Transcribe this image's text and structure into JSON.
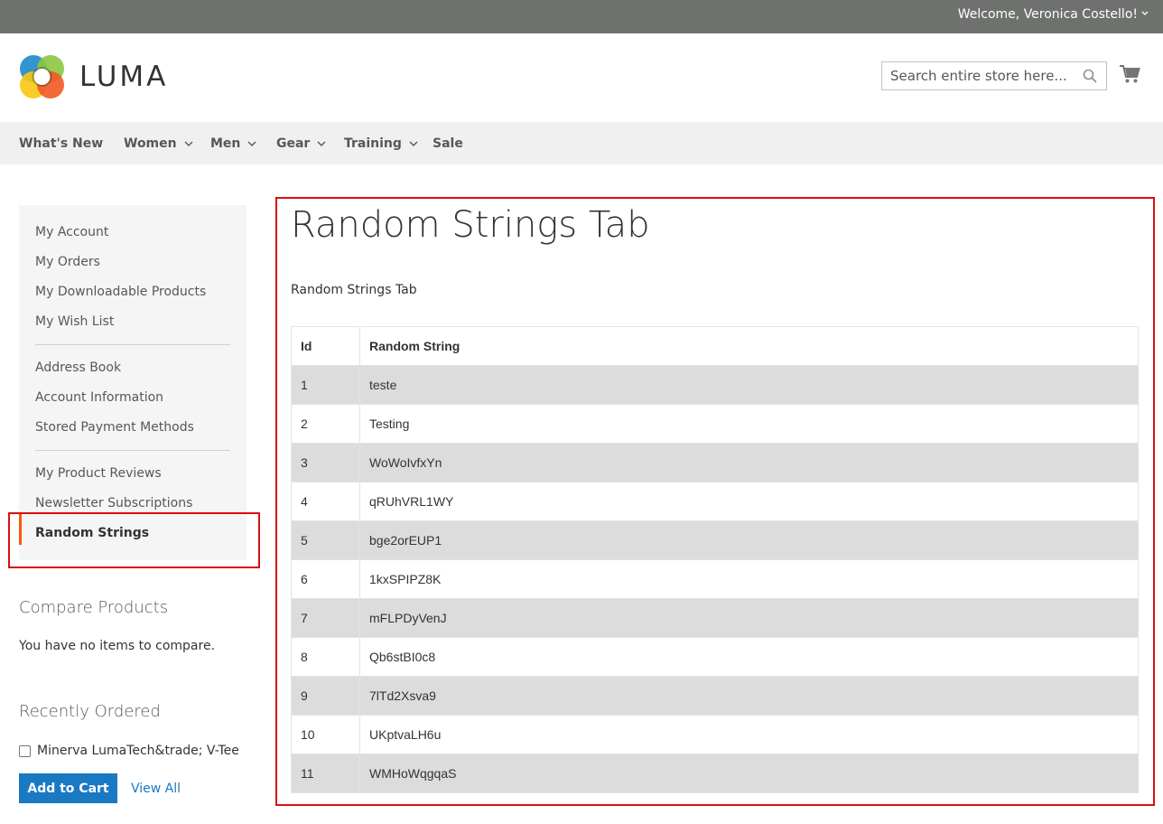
{
  "header": {
    "welcome": "Welcome, Veronica Costello!",
    "logo_text": "LUMA",
    "search_placeholder": "Search entire store here..."
  },
  "nav": {
    "items": [
      {
        "label": "What's New"
      },
      {
        "label": "Women"
      },
      {
        "label": "Men"
      },
      {
        "label": "Gear"
      },
      {
        "label": "Training"
      },
      {
        "label": "Sale"
      }
    ]
  },
  "sidebar": {
    "items": [
      {
        "label": "My Account"
      },
      {
        "label": "My Orders"
      },
      {
        "label": "My Downloadable Products"
      },
      {
        "label": "My Wish List"
      },
      {
        "label": "Address Book"
      },
      {
        "label": "Account Information"
      },
      {
        "label": "Stored Payment Methods"
      },
      {
        "label": "My Product Reviews"
      },
      {
        "label": "Newsletter Subscriptions"
      },
      {
        "label": "Random Strings"
      }
    ]
  },
  "compare": {
    "title": "Compare Products",
    "empty_text": "You have no items to compare."
  },
  "recent": {
    "title": "Recently Ordered",
    "item": "Minerva LumaTech&trade; V-Tee",
    "add_to_cart": "Add to Cart",
    "view_all": "View All"
  },
  "main": {
    "title": "Random Strings Tab",
    "subtitle": "Random Strings Tab",
    "table": {
      "headers": [
        "Id",
        "Random String"
      ],
      "rows": [
        [
          "1",
          "teste"
        ],
        [
          "2",
          "Testing"
        ],
        [
          "3",
          "WoWoIvfxYn"
        ],
        [
          "4",
          "qRUhVRL1WY"
        ],
        [
          "5",
          "bge2orEUP1"
        ],
        [
          "6",
          "1kxSPIPZ8K"
        ],
        [
          "7",
          "mFLPDyVenJ"
        ],
        [
          "8",
          "Qb6stBI0c8"
        ],
        [
          "9",
          "7lTd2Xsva9"
        ],
        [
          "10",
          "UKptvaLH6u"
        ],
        [
          "11",
          "WMHoWqgqaS"
        ]
      ]
    }
  },
  "colors": {
    "topbar": "#6e716e",
    "accent_blue": "#1979c3",
    "active_orange": "#ff5501",
    "highlight_red": "#d90f0f"
  }
}
